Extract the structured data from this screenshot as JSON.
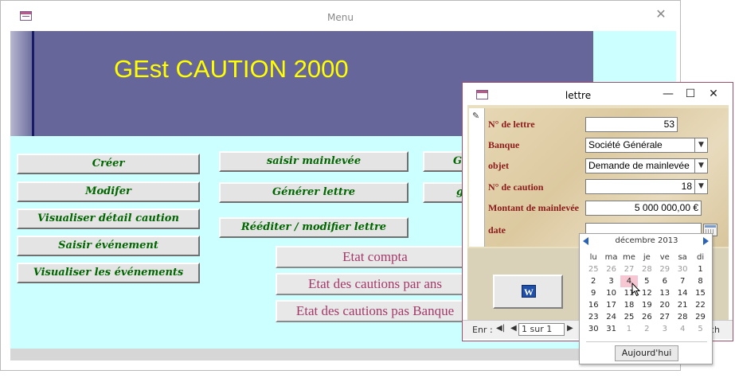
{
  "menu_window": {
    "title": "Menu",
    "close_glyph": "✕",
    "banner_title": "GEst CAUTION 2000",
    "buttons_col1": [
      "Créer",
      "Modifer",
      "Visualiser détail caution",
      "Saisir événement",
      "Visualiser les événements"
    ],
    "buttons_col2": [
      "saisir mainlevée",
      "Générer lettre",
      "Rééditer / modifier lettre"
    ],
    "buttons_col3": [
      "G",
      "g"
    ],
    "report_buttons": [
      "Etat compta",
      "Etat des cautions par ans",
      "Etat des cautions pas Banque"
    ]
  },
  "lettre_window": {
    "title": "lettre",
    "controls": {
      "minimize": "—",
      "maximize": "☐",
      "close": "✕"
    },
    "fields": {
      "numero_lettre": {
        "label": "N° de lettre",
        "value": "53"
      },
      "banque": {
        "label": "Banque",
        "value": "Société Générale"
      },
      "objet": {
        "label": "objet",
        "value": "Demande de mainlevée"
      },
      "numero_caution": {
        "label": "N° de caution",
        "value": "18"
      },
      "montant": {
        "label": "Montant de mainlevée",
        "value": "5 000 000,00 €"
      },
      "date": {
        "label": "date",
        "value": ""
      }
    },
    "word_button_icon": "W",
    "navigation": {
      "label": "Enr :",
      "first": "◀|",
      "prev": "◀",
      "counter": "1 sur 1",
      "next": "▶",
      "search_fragment": "ch"
    }
  },
  "date_picker": {
    "month_label": "décembre 2013",
    "weekdays": [
      "lu",
      "ma",
      "me",
      "je",
      "ve",
      "sa",
      "di"
    ],
    "weeks": [
      [
        "25",
        "26",
        "27",
        "28",
        "29",
        "30",
        "1"
      ],
      [
        "2",
        "3",
        "4",
        "5",
        "6",
        "7",
        "8"
      ],
      [
        "9",
        "10",
        "11",
        "12",
        "13",
        "14",
        "15"
      ],
      [
        "16",
        "17",
        "18",
        "19",
        "20",
        "21",
        "22"
      ],
      [
        "23",
        "24",
        "25",
        "26",
        "27",
        "28",
        "29"
      ],
      [
        "30",
        "31",
        "1",
        "2",
        "3",
        "4",
        "5"
      ]
    ],
    "today_button": "Aujourd'hui",
    "selected_day": "4"
  },
  "colors": {
    "menu_background": "#ccffff",
    "banner": "#66669a",
    "banner_title": "#ffff00",
    "button_text_green": "#006600",
    "report_text": "#a23a6a",
    "field_labels": "#8b1a1a",
    "selected_day_bg": "#f6c6d2"
  }
}
